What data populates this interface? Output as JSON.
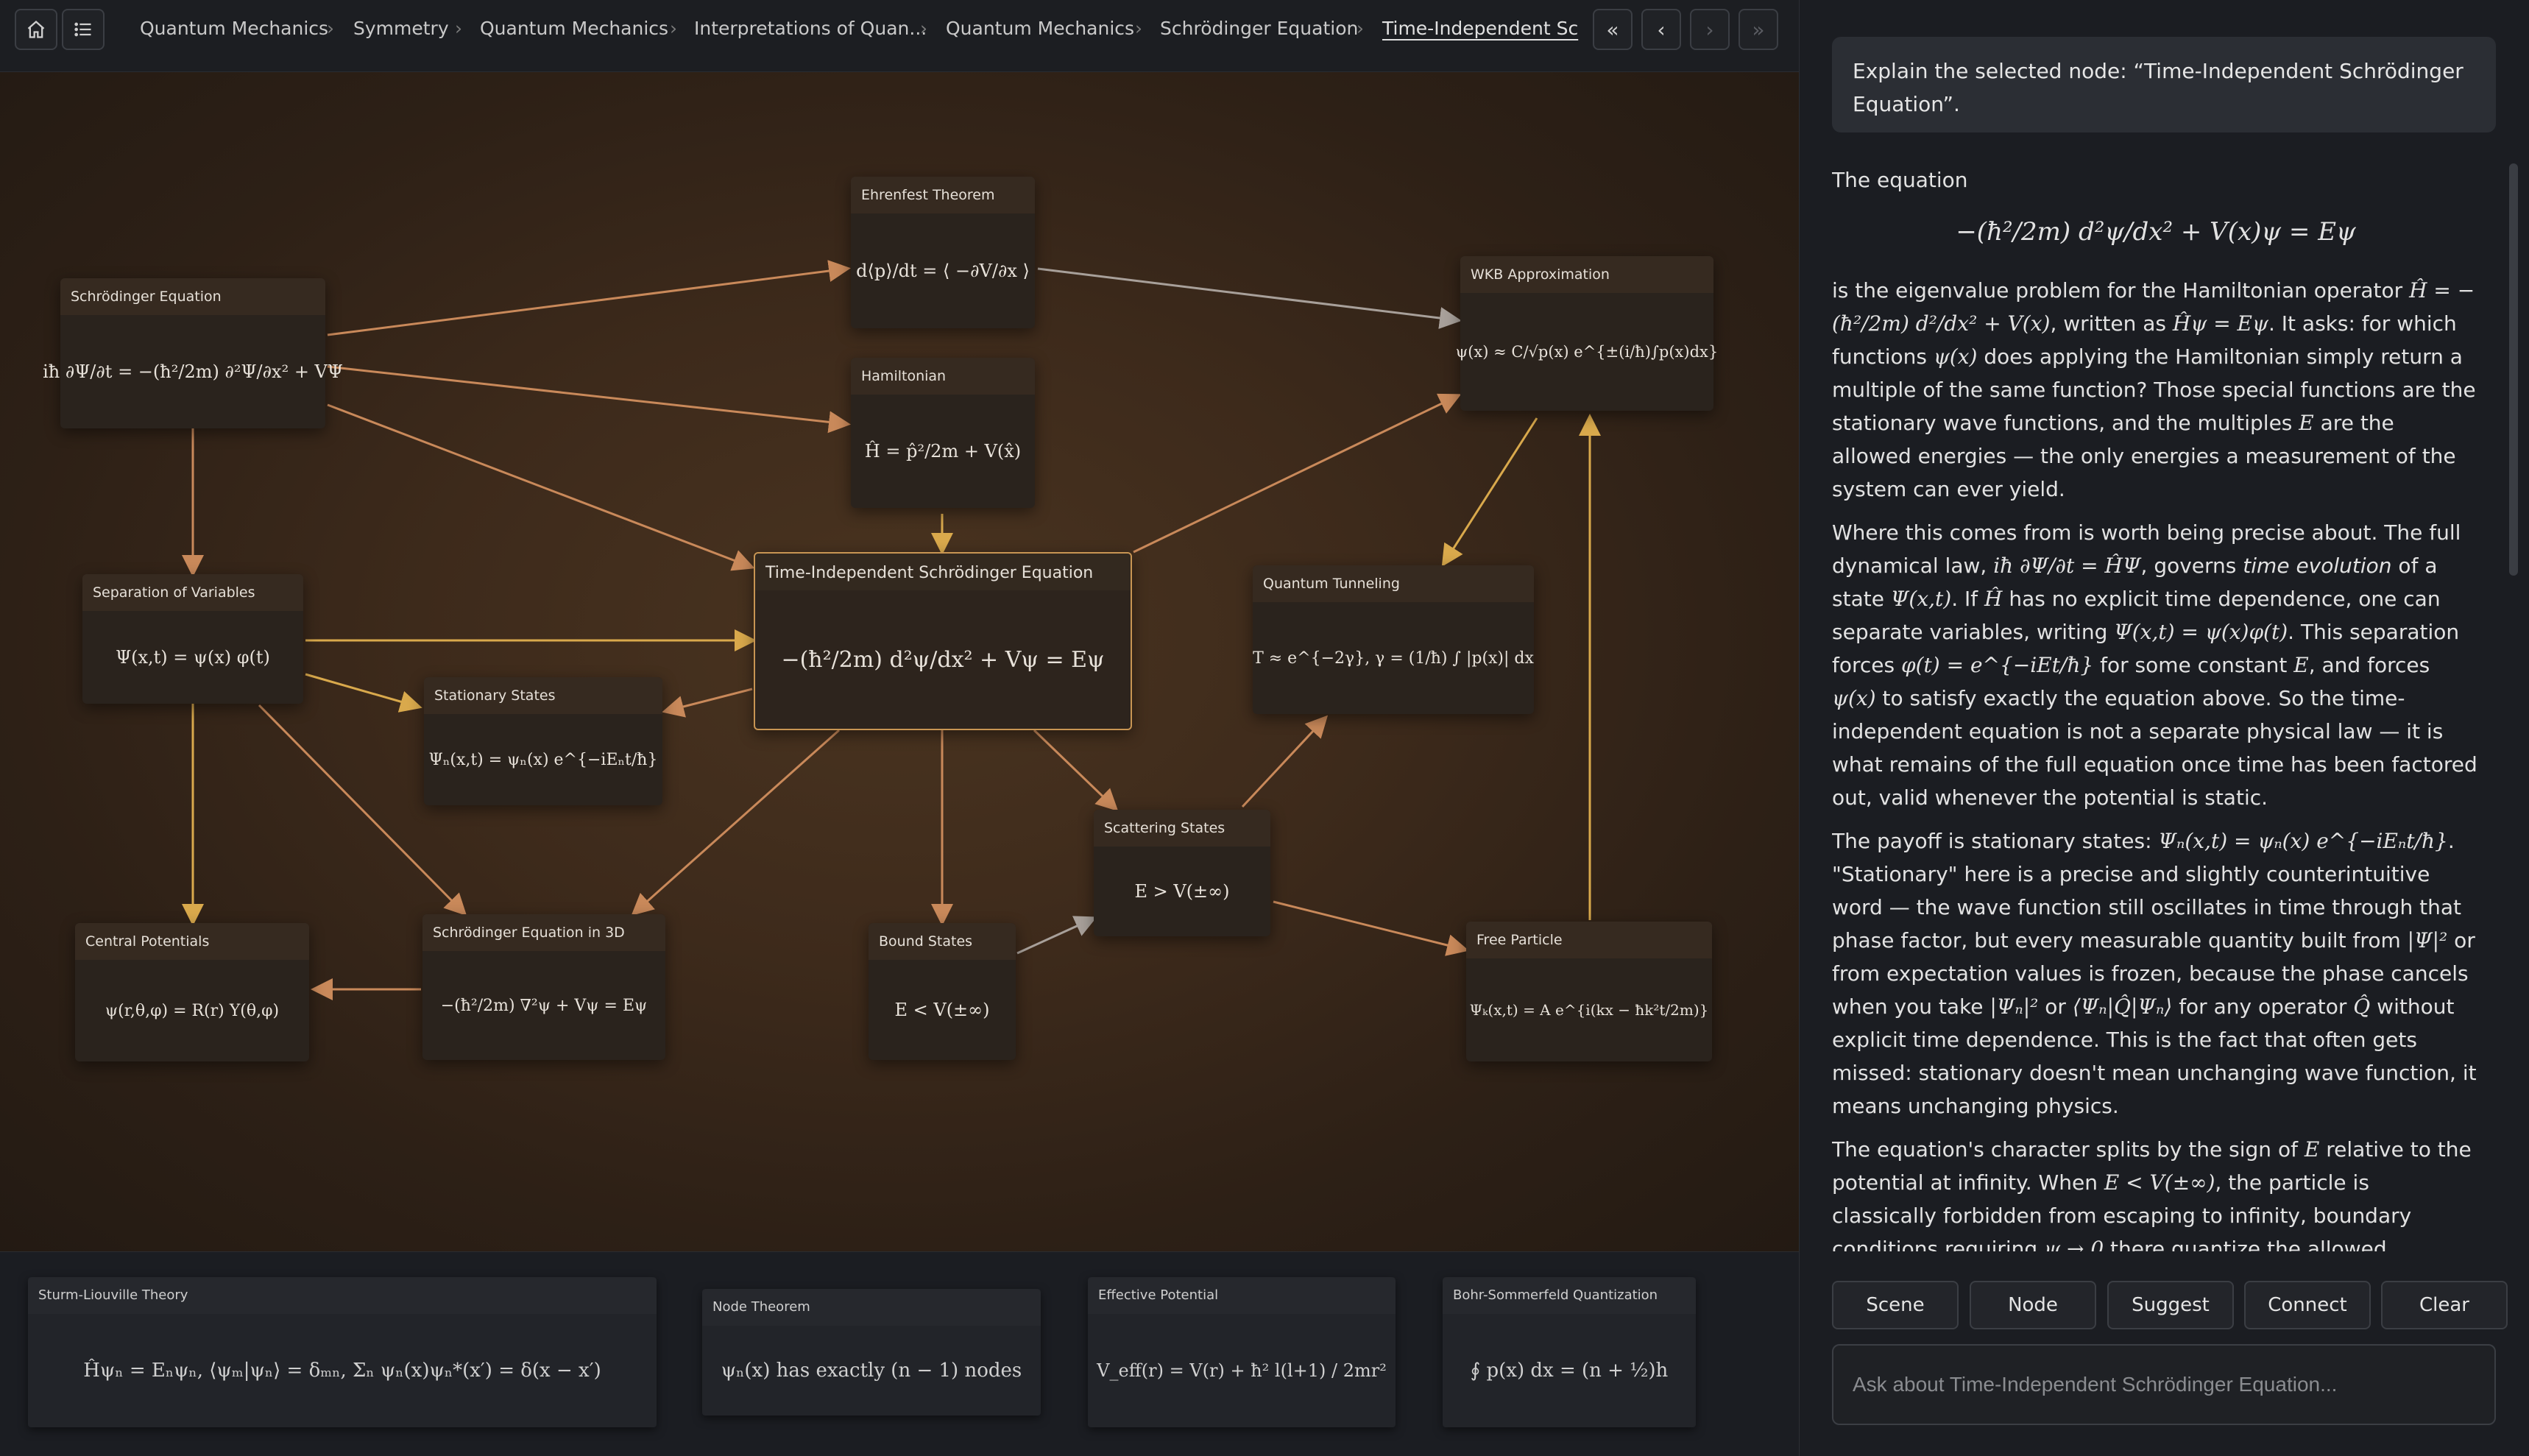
{
  "topbar": {
    "home_icon": "home-icon",
    "list_icon": "list-icon",
    "breadcrumbs": [
      "Quantum Mechanics",
      "Symmetry",
      "Quantum Mechanics",
      "Interpretations of Quan...",
      "Quantum Mechanics",
      "Schrödinger Equation",
      "Time-Independent Sc"
    ],
    "separator": "›",
    "nav": {
      "first": "«",
      "prev": "‹",
      "next": "›",
      "last": "»"
    }
  },
  "graph": {
    "accent_color": "#c89553",
    "nodes": {
      "ehrenfest": {
        "title": "Ehrenfest Theorem",
        "formula": "d⟨p⟩/dt = ⟨ −∂V/∂x ⟩"
      },
      "schrodinger": {
        "title": "Schrödinger Equation",
        "formula": "iħ ∂Ψ/∂t = −(ħ²/2m) ∂²Ψ/∂x² + VΨ"
      },
      "hamiltonian": {
        "title": "Hamiltonian",
        "formula": "Ĥ = p̂²/2m + V(x̂)"
      },
      "wkb": {
        "title": "WKB Approximation",
        "formula": "ψ(x) ≈ C/√p(x) e^{±(i/ħ)∫p(x)dx}"
      },
      "tise": {
        "title": "Time-Independent Schrödinger Equation",
        "formula": "−(ħ²/2m) d²ψ/dx² + Vψ = Eψ"
      },
      "separation": {
        "title": "Separation of Variables",
        "formula": "Ψ(x,t) = ψ(x) φ(t)"
      },
      "tunneling": {
        "title": "Quantum Tunneling",
        "formula": "T ≈ e^{−2γ},   γ = (1/ħ) ∫ |p(x)| dx"
      },
      "stationary": {
        "title": "Stationary States",
        "formula": "Ψₙ(x,t) = ψₙ(x) e^{−iEₙt/ħ}"
      },
      "scattering": {
        "title": "Scattering States",
        "formula": "E > V(±∞)"
      },
      "central": {
        "title": "Central Potentials",
        "formula": "ψ(r,θ,φ) = R(r) Y(θ,φ)"
      },
      "schrodinger3d": {
        "title": "Schrödinger Equation in 3D",
        "formula": "−(ħ²/2m) ∇²ψ + Vψ = Eψ"
      },
      "bound": {
        "title": "Bound States",
        "formula": "E < V(±∞)"
      },
      "free": {
        "title": "Free Particle",
        "formula": "Ψₖ(x,t) = A e^{i(kx − ħk²t/2m)}"
      }
    }
  },
  "tray": [
    {
      "title": "Sturm-Liouville Theory",
      "formula": "Ĥψₙ = Eₙψₙ,   ⟨ψₘ|ψₙ⟩ = δₘₙ,   Σₙ ψₙ(x)ψₙ*(x′) = δ(x − x′)"
    },
    {
      "title": "Node Theorem",
      "formula": "ψₙ(x) has exactly (n − 1) nodes"
    },
    {
      "title": "Effective Potential",
      "formula": "V_eff(r) = V(r) + ħ² l(l+1) / 2mr²"
    },
    {
      "title": "Bohr-Sommerfeld Quantization",
      "formula": "∮ p(x) dx = (n + ½)h"
    }
  ],
  "panel": {
    "user_message": "Explain the selected node: “Time-Independent Schrödinger Equation”.",
    "answer": {
      "intro": "The equation",
      "display_eq": "−(ħ²/2m) d²ψ/dx² + V(x)ψ = Eψ",
      "p1": [
        "is the eigenvalue problem for the Hamiltonian operator ",
        "Ĥ = −(ħ²/2m) d²/dx² + V(x)",
        ", written as ",
        "Ĥψ = Eψ",
        ". It asks: for which functions ",
        "ψ(x)",
        " does applying the Hamiltonian simply return a multiple of the same function? Those special functions are the stationary wave functions, and the multiples ",
        "E",
        " are the allowed energies — the only energies a measurement of the system can ever yield."
      ],
      "p2": [
        "Where this comes from is worth being precise about. The full dynamical law, ",
        "iħ ∂Ψ/∂t = ĤΨ",
        ", governs ",
        "time evolution",
        " of a state ",
        "Ψ(x,t)",
        ". If ",
        "Ĥ",
        " has no explicit time dependence, one can separate variables, writing ",
        "Ψ(x,t) = ψ(x)φ(t)",
        ". This separation forces ",
        "φ(t) = e^{−iEt/ħ}",
        " for some constant ",
        "E",
        ", and forces ",
        "ψ(x)",
        " to satisfy exactly the equation above. So the time-independent equation is not a separate physical law — it is what remains of the full equation once time has been factored out, valid whenever the potential is static."
      ],
      "p3": [
        "The payoff is stationary states: ",
        "Ψₙ(x,t) = ψₙ(x) e^{−iEₙt/ħ}",
        ". \"Stationary\" here is a precise and slightly counterintuitive word — the wave function still oscillates in time through that phase factor, but every measurable quantity built from ",
        "|Ψ|²",
        " or from expectation values is frozen, because the phase cancels when you take ",
        "|Ψₙ|²",
        " or ",
        "⟨Ψₙ|Q̂|Ψₙ⟩",
        " for any operator ",
        "Q̂",
        " without explicit time dependence. This is the fact that often gets missed: stationary doesn't mean unchanging wave function, it means unchanging physics."
      ],
      "p4": [
        "The equation's character splits by the sign of ",
        "E",
        " relative to the potential at infinity. When ",
        "E < V(±∞)",
        ", the particle is classically forbidden from escaping to infinity, boundary conditions requiring ",
        "ψ → 0",
        " there quantize the allowed energies into a discrete spectrum — bound states, like the ones in a well or an atom. When"
      ]
    },
    "actions": [
      "Scene",
      "Node",
      "Suggest",
      "Connect",
      "Clear"
    ],
    "input_placeholder": "Ask about Time-Independent Schrödinger Equation..."
  }
}
